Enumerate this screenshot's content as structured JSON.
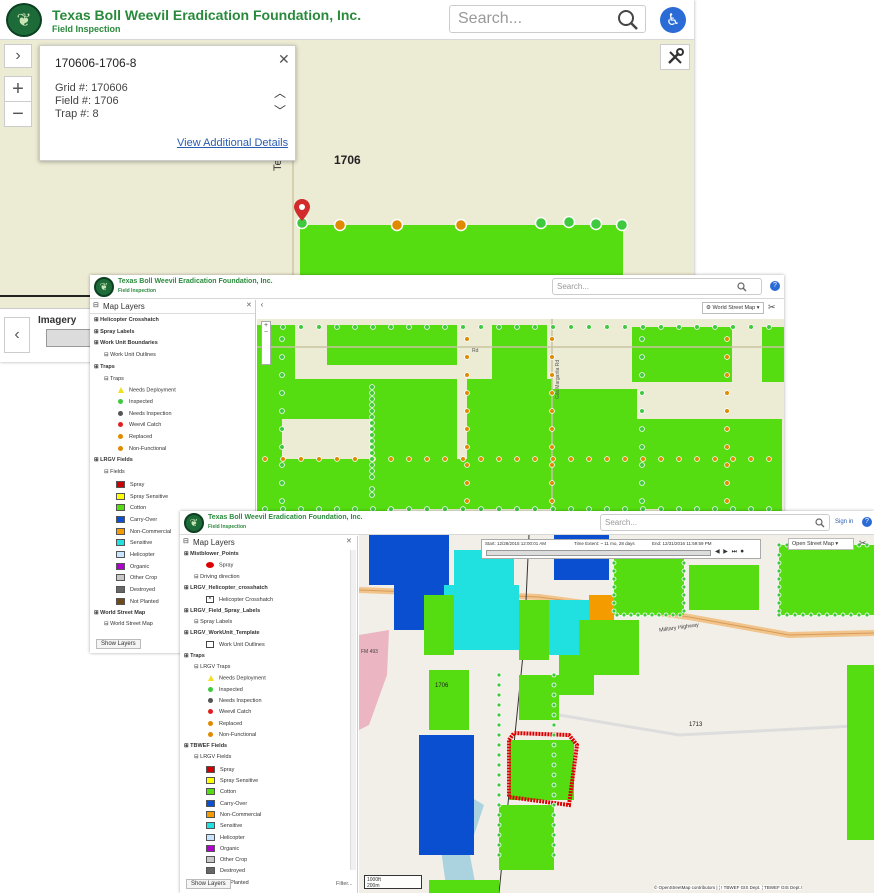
{
  "app": {
    "title": "Texas Boll Weevil Eradication Foundation, Inc.",
    "subtitle": "Field Inspection"
  },
  "win1": {
    "search_placeholder": "Search...",
    "popup": {
      "title": "170606-1706-8",
      "grid": "Grid #: 170606",
      "field": "Field #: 1706",
      "trap": "Trap #: 8",
      "link": "View Additional Details"
    },
    "field_label": "1706",
    "road_label": "Tecia Rd",
    "basemap_label": "Imagery"
  },
  "win2": {
    "search_placeholder": "Search...",
    "panel_title": "Map Layers",
    "basemap": "World Street Map",
    "road_labels": [
      "Rd",
      "Gila Margarita Rd"
    ],
    "layers": [
      {
        "label": "Helicopter Crosshatch",
        "bold": true
      },
      {
        "label": "Spray Labels",
        "bold": true
      },
      {
        "label": "Work Unit Boundaries",
        "bold": true
      },
      {
        "label": "Work Unit Outlines",
        "bold": false
      },
      {
        "label": "Traps",
        "bold": true
      },
      {
        "label": "Traps",
        "bold": false
      },
      {
        "label": "Needs Deployment",
        "bold": false,
        "color": "#f0e020",
        "shape": "triangle"
      },
      {
        "label": "Inspected",
        "bold": false,
        "color": "#3ec93e",
        "shape": "dot"
      },
      {
        "label": "Needs Inspection",
        "bold": false,
        "color": "#555555",
        "shape": "dot"
      },
      {
        "label": "Weevil Catch",
        "bold": false,
        "color": "#e02020",
        "shape": "dot"
      },
      {
        "label": "Replaced",
        "bold": false,
        "color": "#e08a00",
        "shape": "dot"
      },
      {
        "label": "Non-Functional",
        "bold": false,
        "color": "#e08a00",
        "shape": "dot"
      },
      {
        "label": "LRGV Fields",
        "bold": true
      },
      {
        "label": "Fields",
        "bold": false
      },
      {
        "label": "Spray",
        "bold": false,
        "color": "#cc0000",
        "shape": "sq"
      },
      {
        "label": "Spray Sensitive",
        "bold": false,
        "color": "#ffff00",
        "shape": "sq"
      },
      {
        "label": "Cotton",
        "bold": false,
        "color": "#55dd11",
        "shape": "sq"
      },
      {
        "label": "Carry-Over",
        "bold": false,
        "color": "#0a4fcf",
        "shape": "sq"
      },
      {
        "label": "Non-Commercial",
        "bold": false,
        "color": "#f49b00",
        "shape": "sq"
      },
      {
        "label": "Sensitive",
        "bold": false,
        "color": "#20e0e0",
        "shape": "sq"
      },
      {
        "label": "Helicopter",
        "bold": false,
        "color": "#c8e4ff",
        "shape": "sq"
      },
      {
        "label": "Organic",
        "bold": false,
        "color": "#b000d0",
        "shape": "sq"
      },
      {
        "label": "Other Crop",
        "bold": false,
        "color": "#c8c8c8",
        "shape": "sq"
      },
      {
        "label": "Destroyed",
        "bold": false,
        "color": "#666666",
        "shape": "sq"
      },
      {
        "label": "Not Planted",
        "bold": false,
        "color": "#6e4a18",
        "shape": "sq"
      },
      {
        "label": "World Street Map",
        "bold": true
      },
      {
        "label": "World Street Map",
        "bold": false
      }
    ],
    "show_layers": "Show Layers"
  },
  "win3": {
    "search_placeholder": "Search...",
    "sign_in": "Sign in",
    "panel_title": "Map Layers",
    "basemap": "Open Street Map",
    "time": {
      "start": "Start: 12/28/2015 12:00:01 AM",
      "extent": "Time Extent: ~ 11 mo, 28 days",
      "end": "End: 12/31/2016 11:59:59 PM"
    },
    "map_labels": [
      "Military Highway",
      "1706",
      "1713",
      "FM 493"
    ],
    "scale": [
      "1000ft",
      "200m"
    ],
    "attribution": "© OpenStreetMap contributors | ¦ ! TBWEF GIS Dept. ¦ TBWEF GIS Dept.!",
    "layers": [
      {
        "label": "Mistblower_Points",
        "bold": true
      },
      {
        "label": "Spray",
        "bold": false,
        "color": "#dd0000",
        "shape": "ell"
      },
      {
        "label": "Driving direction",
        "bold": false
      },
      {
        "label": "LRGV_Helicopter_crosshatch",
        "bold": true
      },
      {
        "label": "Helicopter Crosshatch",
        "bold": false,
        "shape": "xbox"
      },
      {
        "label": "LRGV_Field_Spray_Labels",
        "bold": true
      },
      {
        "label": "Spray Labels",
        "bold": false
      },
      {
        "label": "LRGV_WorkUnit_Template",
        "bold": true
      },
      {
        "label": "Work Unit Outlines",
        "bold": false,
        "shape": "box"
      },
      {
        "label": "Traps",
        "bold": true
      },
      {
        "label": "LRGV Traps",
        "bold": false
      },
      {
        "label": "Needs Deployment",
        "bold": false,
        "color": "#f0e020",
        "shape": "triangle"
      },
      {
        "label": "Inspected",
        "bold": false,
        "color": "#3ec93e",
        "shape": "dot"
      },
      {
        "label": "Needs Inspection",
        "bold": false,
        "color": "#555555",
        "shape": "dot"
      },
      {
        "label": "Weevil Catch",
        "bold": false,
        "color": "#e02020",
        "shape": "dot"
      },
      {
        "label": "Replaced",
        "bold": false,
        "color": "#e08a00",
        "shape": "dot"
      },
      {
        "label": "Non-Functional",
        "bold": false,
        "color": "#e08a00",
        "shape": "dot"
      },
      {
        "label": "TBWEF Fields",
        "bold": true
      },
      {
        "label": "LRGV Fields",
        "bold": false
      },
      {
        "label": "Spray",
        "bold": false,
        "color": "#cc0000",
        "shape": "sq"
      },
      {
        "label": "Spray Sensitive",
        "bold": false,
        "color": "#ffff00",
        "shape": "sq"
      },
      {
        "label": "Cotton",
        "bold": false,
        "color": "#55dd11",
        "shape": "sq"
      },
      {
        "label": "Carry-Over",
        "bold": false,
        "color": "#0a4fcf",
        "shape": "sq"
      },
      {
        "label": "Non-Commercial",
        "bold": false,
        "color": "#f49b00",
        "shape": "sq"
      },
      {
        "label": "Sensitive",
        "bold": false,
        "color": "#20e0e0",
        "shape": "sq"
      },
      {
        "label": "Helicopter",
        "bold": false,
        "color": "#c8e4ff",
        "shape": "sq"
      },
      {
        "label": "Organic",
        "bold": false,
        "color": "#b000d0",
        "shape": "sq"
      },
      {
        "label": "Other Crop",
        "bold": false,
        "color": "#c8c8c8",
        "shape": "sq"
      },
      {
        "label": "Destroyed",
        "bold": false,
        "color": "#666666",
        "shape": "sq"
      },
      {
        "label": "Not Planted",
        "bold": false,
        "color": "#6e4a18",
        "shape": "sq"
      }
    ],
    "show_layers": "Show Layers",
    "filter": "Filter..."
  }
}
